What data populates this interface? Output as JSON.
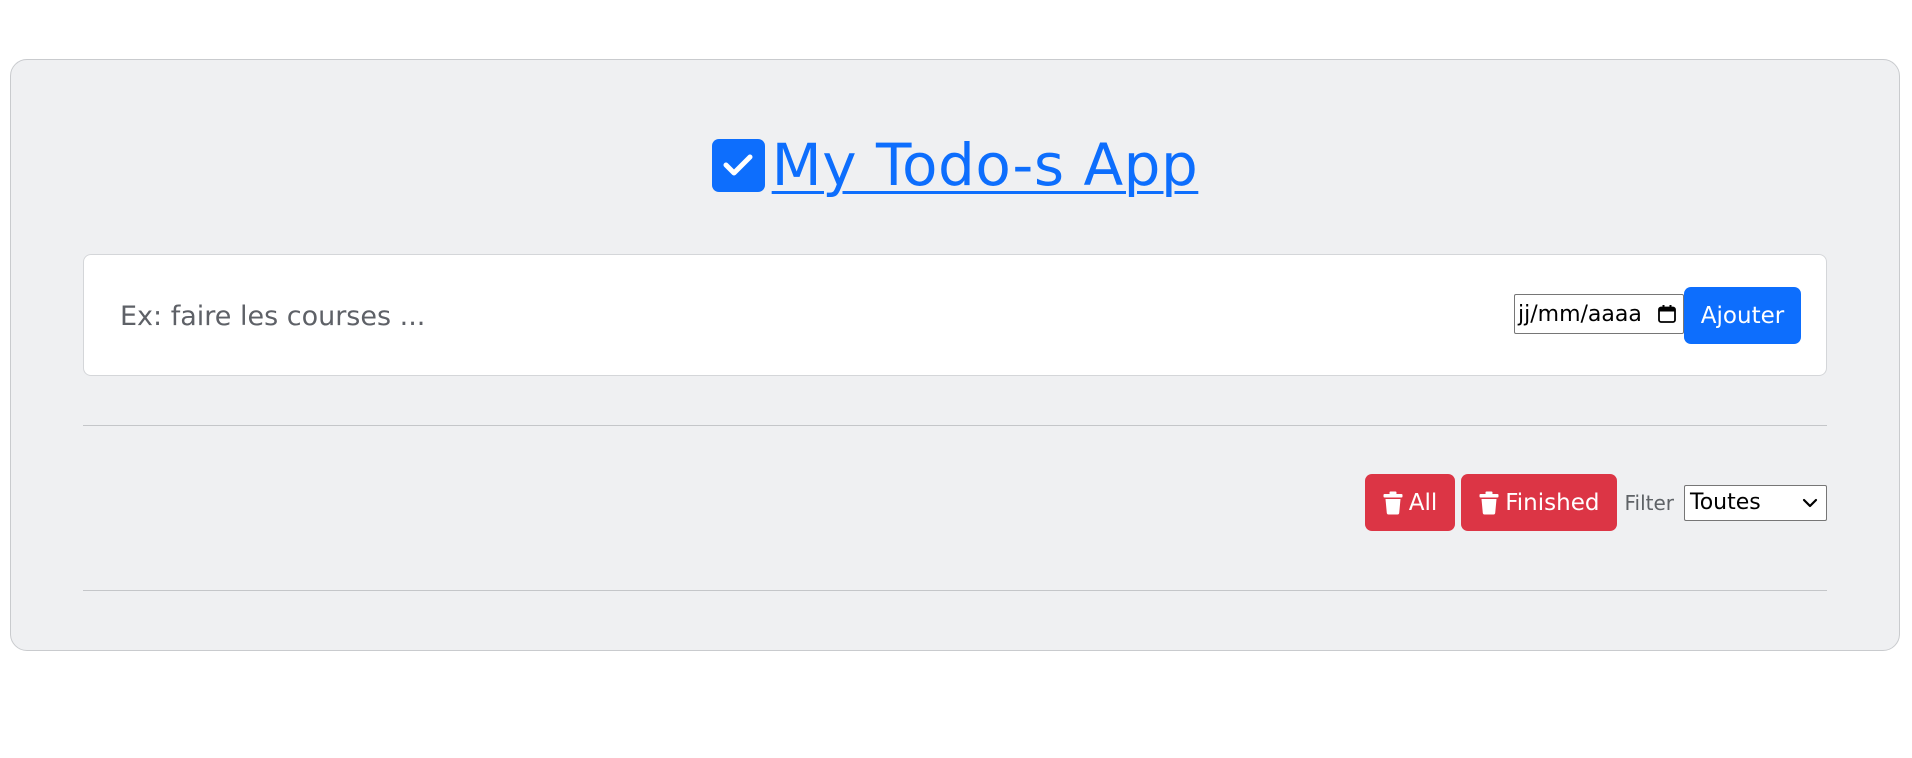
{
  "app": {
    "title": "My Todo-s App",
    "title_icon": "check-square-icon",
    "accent_color": "#0d6efd"
  },
  "add_form": {
    "input": {
      "value": "",
      "placeholder": "Ex: faire les courses ..."
    },
    "date": {
      "placeholder": "jj/mm/aaaa",
      "icon": "calendar-icon"
    },
    "add_label": "Ajouter"
  },
  "actions": {
    "delete_all_label": "All",
    "delete_finished_label": "Finished",
    "delete_icon": "trash-icon",
    "danger_color": "#dc3545",
    "filter_label": "Filter",
    "filter_selected": "Toutes"
  }
}
